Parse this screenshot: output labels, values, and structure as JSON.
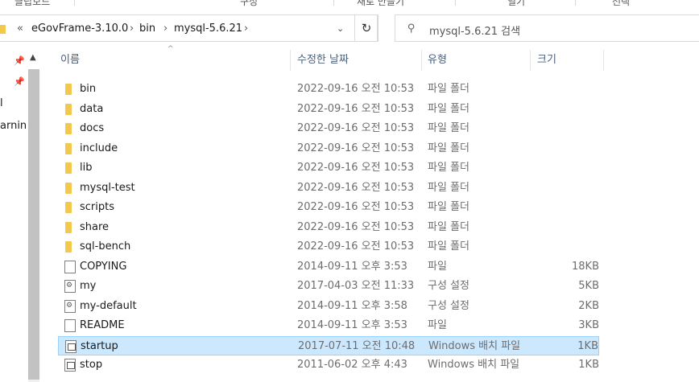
{
  "ribbon": {
    "groups": [
      "클립보드",
      "구성",
      "새로 만들기",
      "열기",
      "선택"
    ]
  },
  "address": {
    "overflow": "«",
    "crumbs": [
      "eGovFrame-3.10.0",
      "bin",
      "mysql-5.6.21"
    ],
    "separator": "›",
    "dropdown": "⌄",
    "refresh": "↻"
  },
  "search": {
    "placeholder": "mysql-5.6.21 검색",
    "icon": "search-icon"
  },
  "nav": {
    "items": [
      "l",
      "arnin"
    ],
    "pin_icon": "pin-icon"
  },
  "columns": {
    "name": "이름",
    "date": "수정한 날짜",
    "type": "유형",
    "size": "크기"
  },
  "files": [
    {
      "name": "bin",
      "date": "2022-09-16 오전 10:53",
      "type": "파일 폴더",
      "size": "",
      "icon": "folder-icon"
    },
    {
      "name": "data",
      "date": "2022-09-16 오전 10:53",
      "type": "파일 폴더",
      "size": "",
      "icon": "folder-icon"
    },
    {
      "name": "docs",
      "date": "2022-09-16 오전 10:53",
      "type": "파일 폴더",
      "size": "",
      "icon": "folder-icon"
    },
    {
      "name": "include",
      "date": "2022-09-16 오전 10:53",
      "type": "파일 폴더",
      "size": "",
      "icon": "folder-icon"
    },
    {
      "name": "lib",
      "date": "2022-09-16 오전 10:53",
      "type": "파일 폴더",
      "size": "",
      "icon": "folder-icon"
    },
    {
      "name": "mysql-test",
      "date": "2022-09-16 오전 10:53",
      "type": "파일 폴더",
      "size": "",
      "icon": "folder-icon"
    },
    {
      "name": "scripts",
      "date": "2022-09-16 오전 10:53",
      "type": "파일 폴더",
      "size": "",
      "icon": "folder-icon"
    },
    {
      "name": "share",
      "date": "2022-09-16 오전 10:53",
      "type": "파일 폴더",
      "size": "",
      "icon": "folder-icon"
    },
    {
      "name": "sql-bench",
      "date": "2022-09-16 오전 10:53",
      "type": "파일 폴더",
      "size": "",
      "icon": "folder-icon"
    },
    {
      "name": "COPYING",
      "date": "2014-09-11 오후 3:53",
      "type": "파일",
      "size": "18KB",
      "icon": "file-icon"
    },
    {
      "name": "my",
      "date": "2017-04-03 오전 11:33",
      "type": "구성 설정",
      "size": "5KB",
      "icon": "config-file-icon"
    },
    {
      "name": "my-default",
      "date": "2014-09-11 오후 3:58",
      "type": "구성 설정",
      "size": "2KB",
      "icon": "config-file-icon"
    },
    {
      "name": "README",
      "date": "2014-09-11 오후 3:53",
      "type": "파일",
      "size": "3KB",
      "icon": "file-icon"
    },
    {
      "name": "startup",
      "date": "2017-07-11 오전 10:48",
      "type": "Windows 배치 파일",
      "size": "1KB",
      "icon": "batch-file-icon",
      "selected": true
    },
    {
      "name": "stop",
      "date": "2011-06-02 오후 4:43",
      "type": "Windows 배치 파일",
      "size": "1KB",
      "icon": "batch-file-icon"
    }
  ],
  "colors": {
    "selection_bg": "#cce8ff",
    "selection_border": "#99d1ff",
    "folder": "#f2c94c",
    "header_text": "#4c607a"
  }
}
